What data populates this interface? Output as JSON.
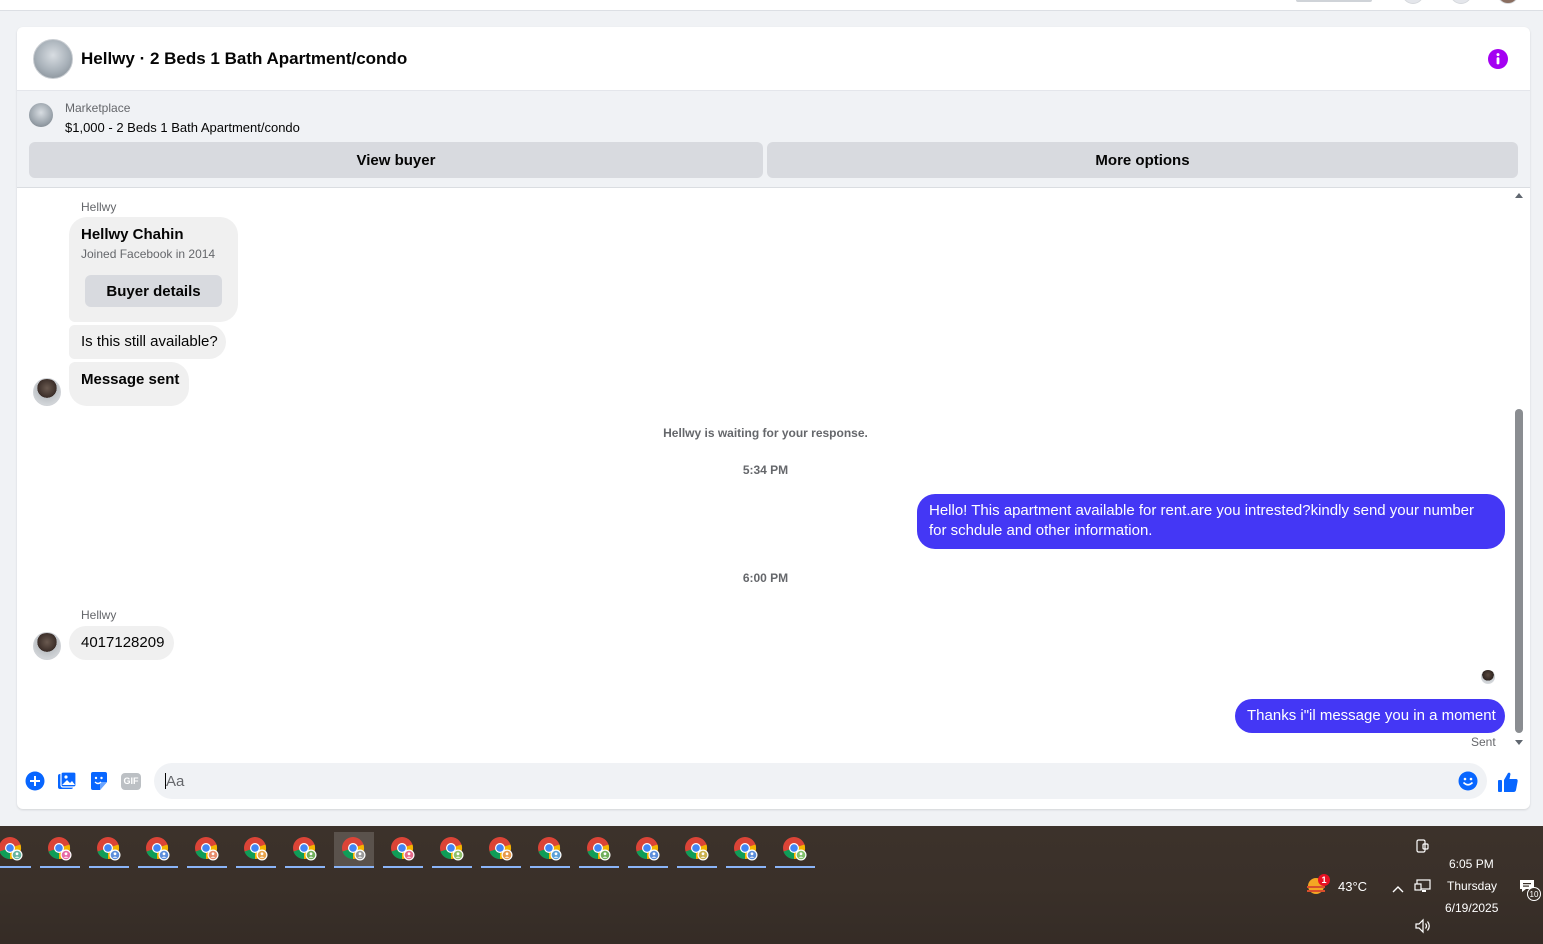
{
  "conversation": {
    "title": "Hellwy · 2 Beds 1 Bath Apartment/condo",
    "info_icon": "info-icon",
    "accent": "#a400f2"
  },
  "listing": {
    "category": "Marketplace",
    "description": "$1,000 - 2 Beds 1 Bath Apartment/condo",
    "view_buyer_label": "View buyer",
    "more_options_label": "More options"
  },
  "messages": {
    "sender_name_1": "Hellwy",
    "profile_card": {
      "name": "Hellwy Chahin",
      "joined": "Joined Facebook in 2014",
      "buyer_details_label": "Buyer details"
    },
    "msg_available": "Is this still available?",
    "msg_sent_card": "Message sent",
    "waiting_note": "Hellwy is waiting for your response.",
    "time_1": "5:34 PM",
    "outgoing_1": "Hello! This apartment available for rent.are you intrested?kindly send your number for schdule and other information.",
    "time_2": "6:00 PM",
    "sender_name_2": "Hellwy",
    "incoming_number": "4017128209",
    "outgoing_2": "Thanks i\"il message you in a moment",
    "status": "Sent",
    "outgoing_color": "#4437f5"
  },
  "composer": {
    "placeholder": "Aa",
    "icons": [
      "plus-icon",
      "photo-icon",
      "sticker-icon",
      "gif-icon",
      "emoji-icon",
      "like-icon"
    ],
    "gif_label": "GIF",
    "icon_color": "#0866ff"
  },
  "taskbar": {
    "app_icon": "chrome-icon",
    "app_count": 17,
    "active_index": 7,
    "weather_temp": "43°C",
    "weather_badge": "1",
    "time": "6:05 PM",
    "day": "Thursday",
    "date": "6/19/2025",
    "notification_count": "10"
  }
}
